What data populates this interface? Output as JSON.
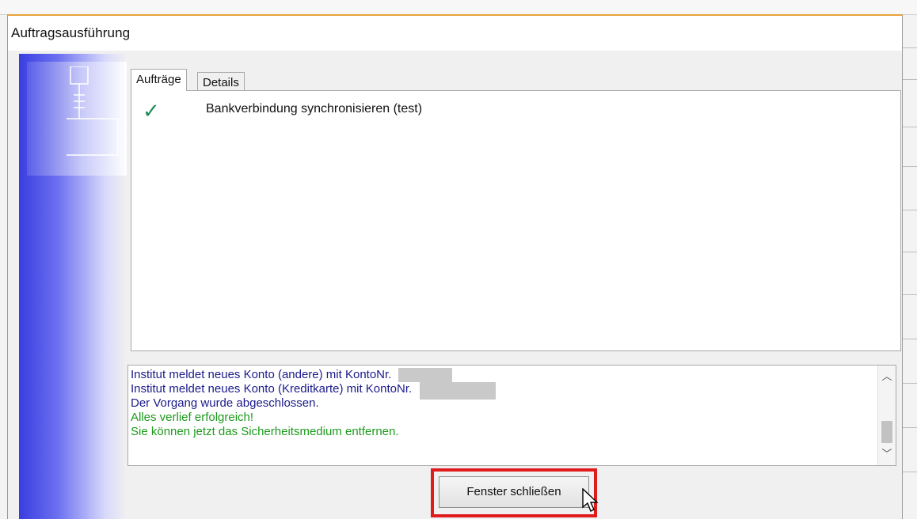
{
  "window": {
    "title": "Auftragsausführung",
    "accent_color": "#e8a13c"
  },
  "tabs": [
    {
      "label": "Aufträge",
      "active": true
    },
    {
      "label": "Details",
      "active": false
    }
  ],
  "jobs": [
    {
      "status_icon": "check-icon",
      "label": "Bankverbindung synchronisieren (test)"
    }
  ],
  "log": {
    "lines": [
      {
        "text": "Institut meldet neues Konto (andere) mit KontoNr.",
        "color": "#1a1a8c",
        "redacted": true
      },
      {
        "text": "Institut meldet neues Konto (Kreditkarte) mit KontoNr.",
        "color": "#1a1a8c",
        "redacted": true
      },
      {
        "text": "Der Vorgang wurde abgeschlossen.",
        "color": "#1a1a8c",
        "redacted": false
      },
      {
        "text": "Alles verlief erfolgreich!",
        "color": "#1c9a1c",
        "redacted": false
      },
      {
        "text": "Sie können jetzt das Sicherheitsmedium entfernen.",
        "color": "#1c9a1c",
        "redacted": false
      }
    ]
  },
  "close_button": {
    "label": "Fenster schließen",
    "highlight_color": "#e01b1b"
  }
}
